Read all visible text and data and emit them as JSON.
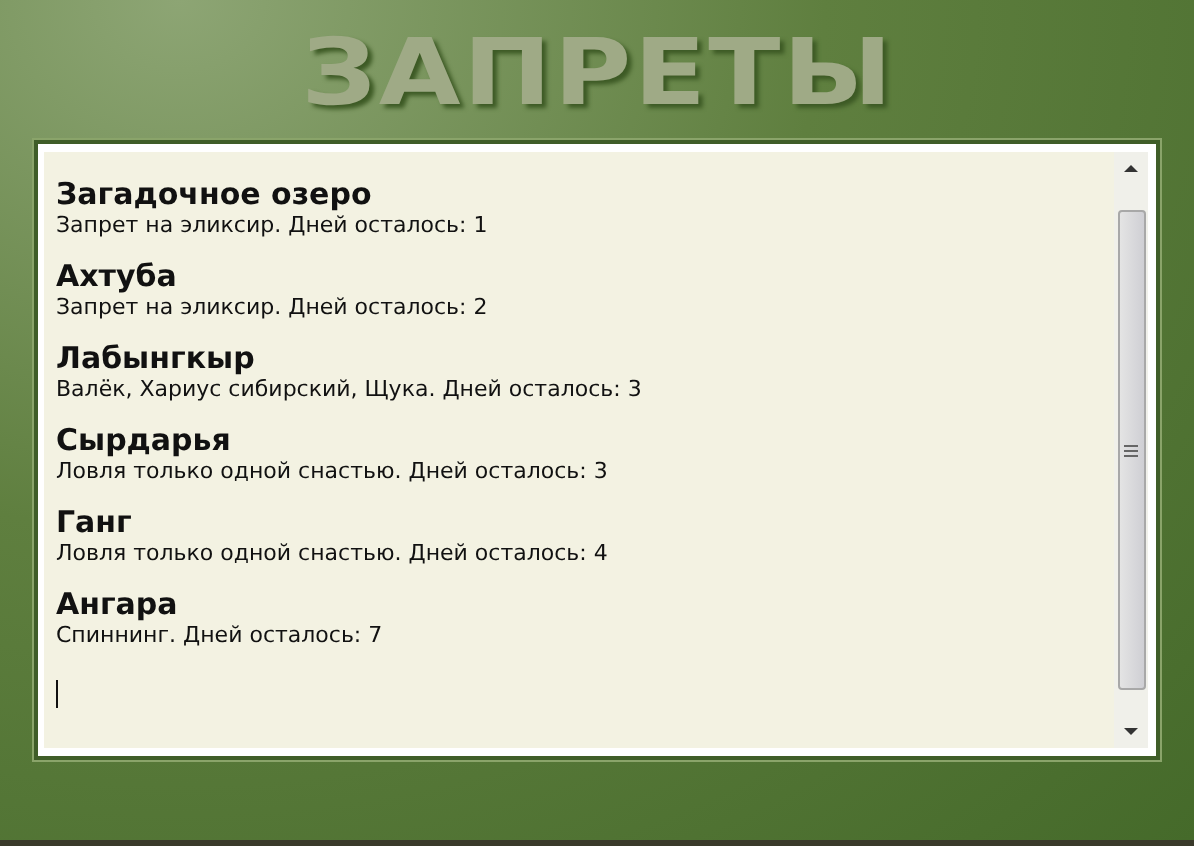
{
  "title": "ЗАПРЕТЫ",
  "entries": [
    {
      "name": "Загадочное озеро",
      "details": "Запрет на эликсир. Дней осталось: 1"
    },
    {
      "name": "Ахтуба",
      "details": "Запрет на эликсир. Дней осталось: 2"
    },
    {
      "name": "Лабынгкыр",
      "details": "Валёк, Хариус сибирский, Щука. Дней осталось: 3"
    },
    {
      "name": "Сырдарья",
      "details": "Ловля только одной снастью. Дней осталось: 3"
    },
    {
      "name": "Ганг",
      "details": "Ловля только одной снастью. Дней осталось: 4"
    },
    {
      "name": "Ангара",
      "details": "Спиннинг. Дней осталось: 7"
    }
  ]
}
